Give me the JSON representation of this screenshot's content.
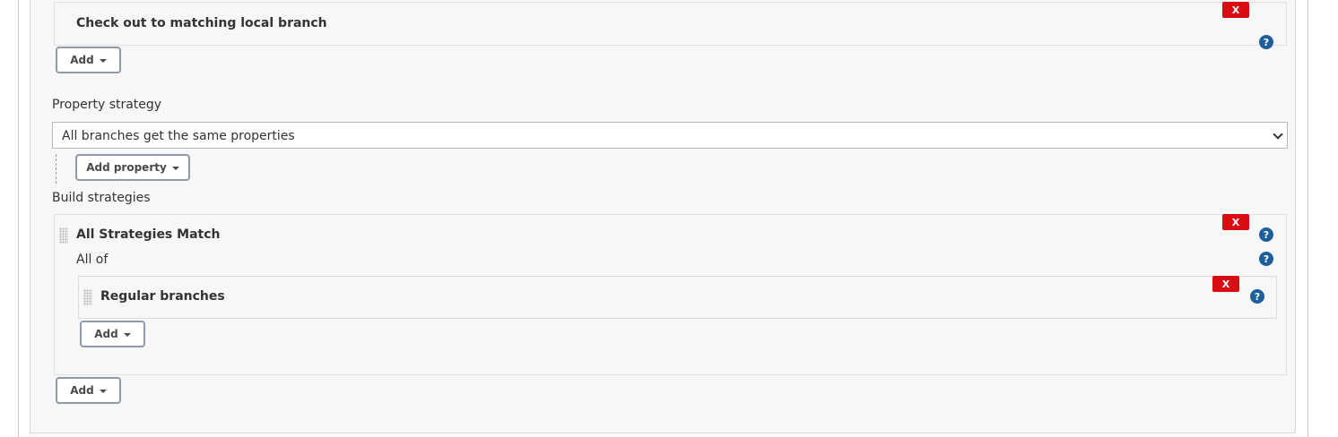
{
  "top_section": {
    "title": "Check out to matching local branch",
    "remove_label": "X",
    "help_label": "?",
    "add_label": "Add"
  },
  "property_strategy": {
    "label": "Property strategy",
    "selected": "All branches get the same properties",
    "add_property_label": "Add property"
  },
  "build_strategies": {
    "label": "Build strategies",
    "strategy": {
      "title": "All Strategies Match",
      "remove_label": "X",
      "help_label": "?",
      "all_of_label": "All of",
      "all_of_help_label": "?",
      "child": {
        "title": "Regular branches",
        "remove_label": "X",
        "help_label": "?"
      },
      "add_label": "Add"
    },
    "add_label": "Add"
  },
  "colors": {
    "remove_button": "#d80d14",
    "help_icon": "#1d5f9a",
    "panel_bg": "#f7f7f7"
  }
}
